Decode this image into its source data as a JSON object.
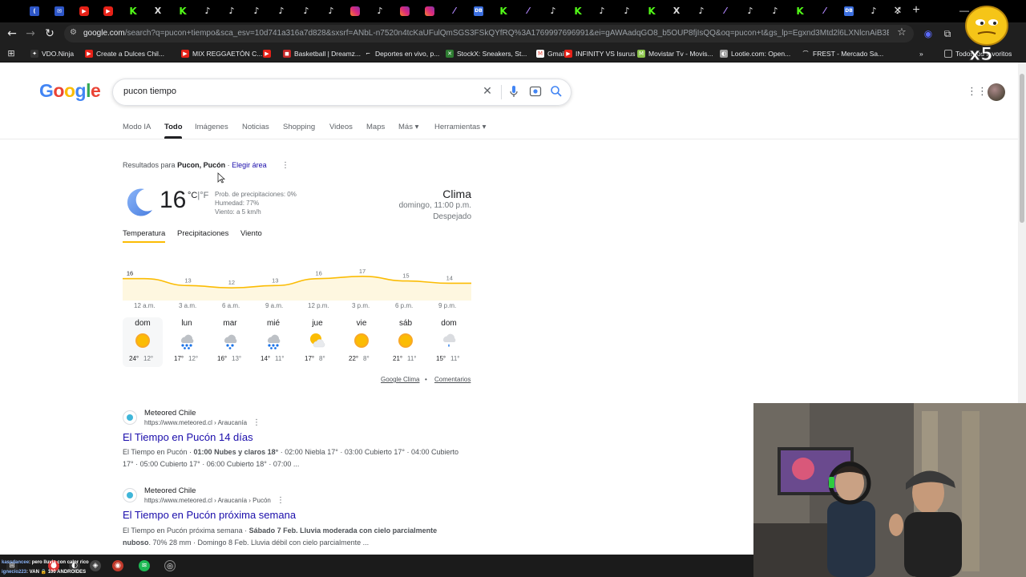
{
  "browser": {
    "tab_favicons": [
      {
        "kind": "msg",
        "glyph": "("
      },
      {
        "kind": "msg",
        "glyph": "✉"
      },
      {
        "kind": "yt",
        "glyph": "▶"
      },
      {
        "kind": "yt",
        "glyph": "▶"
      },
      {
        "kind": "kick",
        "glyph": "K"
      },
      {
        "kind": "x",
        "glyph": "X"
      },
      {
        "kind": "kick",
        "glyph": "K"
      },
      {
        "kind": "tt",
        "glyph": "♪"
      },
      {
        "kind": "tt",
        "glyph": "♪"
      },
      {
        "kind": "tt",
        "glyph": "♪"
      },
      {
        "kind": "tt",
        "glyph": "♪"
      },
      {
        "kind": "tt",
        "glyph": "♪"
      },
      {
        "kind": "tt",
        "glyph": "♪"
      },
      {
        "kind": "ig",
        "glyph": ""
      },
      {
        "kind": "tt",
        "glyph": "♪"
      },
      {
        "kind": "ig",
        "glyph": ""
      },
      {
        "kind": "ig",
        "glyph": ""
      },
      {
        "kind": "feather",
        "glyph": "⁄"
      },
      {
        "kind": "blue",
        "glyph": "DB"
      },
      {
        "kind": "kick",
        "glyph": "K"
      },
      {
        "kind": "feather",
        "glyph": "⁄"
      },
      {
        "kind": "tt",
        "glyph": "♪"
      },
      {
        "kind": "kick",
        "glyph": "K"
      },
      {
        "kind": "tt",
        "glyph": "♪"
      },
      {
        "kind": "tt",
        "glyph": "♪"
      },
      {
        "kind": "kick",
        "glyph": "K"
      },
      {
        "kind": "x",
        "glyph": "X"
      },
      {
        "kind": "tt",
        "glyph": "♪"
      },
      {
        "kind": "feather",
        "glyph": "⁄"
      },
      {
        "kind": "tt",
        "glyph": "♪"
      },
      {
        "kind": "tt",
        "glyph": "♪"
      },
      {
        "kind": "kick",
        "glyph": "K"
      },
      {
        "kind": "feather",
        "glyph": "⁄"
      },
      {
        "kind": "blue",
        "glyph": "DB"
      },
      {
        "kind": "tt",
        "glyph": "♪"
      },
      {
        "kind": "tt",
        "glyph": "♪"
      }
    ],
    "tab_close_glyph": "✕",
    "tab_new_glyph": "+",
    "url_domain": "google.com",
    "url_rest": "/search?q=pucon+tiempo&sca_esv=10d741a316a7d828&sxsrf=ANbL-n7520n4tcKaUFulQmSGS3FSkQYfRQ%3A1769997696991&ei=gAWAadqGO8_b5OUP8fjIsQQ&oq=pucon+t&gs_lp=Egxnd3Mtd2l6LXNlcnAiB3B1Y29uIHQqAggA...",
    "bookmarks": [
      {
        "label": "VDO.Ninja",
        "color": "#333",
        "glyph": "✦"
      },
      {
        "label": "Create a Dulces Chil...",
        "color": "#e62117",
        "glyph": "▶"
      },
      {
        "label": "MIX REGGAETÓN C...",
        "color": "#e62117",
        "glyph": "▶"
      },
      {
        "label": "",
        "color": "#e62117",
        "glyph": "▶"
      },
      {
        "label": "Basketball | Dreamz...",
        "color": "#c62828",
        "glyph": "◼"
      },
      {
        "label": "Deportes en vivo, p...",
        "color": "#1f1f1f",
        "glyph": "⌐"
      },
      {
        "label": "StockX: Sneakers, St...",
        "color": "#2e7d32",
        "glyph": "✕"
      },
      {
        "label": "Gmail",
        "color": "#fff",
        "glyph": "M"
      },
      {
        "label": "INFINITY VS Isurus",
        "color": "#e62117",
        "glyph": "▶"
      },
      {
        "label": "Movistar Tv - Movis...",
        "color": "#8bc34a",
        "glyph": "M"
      },
      {
        "label": "Lootie.com: Open...",
        "color": "#9e9e9e",
        "glyph": "◐"
      },
      {
        "label": "FREST - Mercado Sa...",
        "color": "#1f1f1f",
        "glyph": "⌒"
      }
    ],
    "bookmarks_overflow": "»",
    "all_bookmarks": "Todos los favoritos"
  },
  "search": {
    "query": "pucon tiempo",
    "logo_letters": [
      "G",
      "o",
      "o",
      "g",
      "l",
      "e"
    ],
    "clear_glyph": "✕",
    "mic_glyph": "🎤",
    "lens_glyph": "◎",
    "search_glyph": "⌕",
    "tabs": [
      "Modo IA",
      "Todo",
      "Imágenes",
      "Noticias",
      "Shopping",
      "Videos",
      "Maps",
      "Más ▾",
      "Herramientas ▾"
    ]
  },
  "weather": {
    "results_prefix": "Resultados para",
    "location": "Pucon, Pucón",
    "separator": "·",
    "choose_area": "Elegir área",
    "temp": "16",
    "unit_c": "°C",
    "unit_sep": "|",
    "unit_f": "°F",
    "precip": "Prob. de precipitaciones: 0%",
    "humidity": "Humedad: 77%",
    "wind": "Viento: a 5 km/h",
    "heading": "Clima",
    "when": "domingo, 11:00 p.m.",
    "condition": "Despejado",
    "tabs": [
      "Temperatura",
      "Precipitaciones",
      "Viento"
    ],
    "times": [
      "12 a.m.",
      "3 a.m.",
      "6 a.m.",
      "9 a.m.",
      "12 p.m.",
      "3 p.m.",
      "6 p.m.",
      "9 p.m."
    ],
    "footer_source": "Google Clima",
    "footer_dot": "•",
    "footer_feedback": "Comentarios",
    "days": [
      {
        "name": "dom",
        "icon": "sun",
        "hi": "24°",
        "lo": "12°"
      },
      {
        "name": "lun",
        "icon": "rain",
        "hi": "17°",
        "lo": "12°"
      },
      {
        "name": "mar",
        "icon": "rain-light",
        "hi": "16°",
        "lo": "13°"
      },
      {
        "name": "mié",
        "icon": "rain",
        "hi": "14°",
        "lo": "11°"
      },
      {
        "name": "jue",
        "icon": "partly-cloudy",
        "hi": "17°",
        "lo": "8°"
      },
      {
        "name": "vie",
        "icon": "sun",
        "hi": "22°",
        "lo": "8°"
      },
      {
        "name": "sáb",
        "icon": "sun",
        "hi": "21°",
        "lo": "11°"
      },
      {
        "name": "dom",
        "icon": "showers",
        "hi": "15°",
        "lo": "11°"
      }
    ]
  },
  "chart_data": {
    "type": "area",
    "x": [
      "12 a.m.",
      "3 a.m.",
      "6 a.m.",
      "9 a.m.",
      "12 p.m.",
      "3 p.m.",
      "6 p.m.",
      "9 p.m."
    ],
    "values": [
      16,
      13,
      12,
      13,
      16,
      17,
      15,
      14
    ],
    "color": "#fbbc04",
    "fill": "#fef7e0"
  },
  "results": [
    {
      "site": "Meteored Chile",
      "url": "https://www.meteored.cl › Araucanía",
      "title": "El Tiempo en Pucón 14 días",
      "snippet_1a": "El Tiempo en Pucón · ",
      "snippet_1b": "01:00 Nubes y claros 18°",
      "snippet_1c": " · 02:00 Niebla 17° · 03:00 Cubierto 17° · 04:00 Cubierto",
      "snippet_2": "17° · 05:00 Cubierto 17° · 06:00 Cubierto 18° · 07:00 ..."
    },
    {
      "site": "Meteored Chile",
      "url": "https://www.meteored.cl › Araucanía › Pucón",
      "title": "El Tiempo en Pucón próxima semana",
      "snippet_1a": "El Tiempo en Pucón próxima semana · ",
      "snippet_1b": "Sábado 7 Feb. Lluvia moderada con cielo parcialmente",
      "snippet_2b": "nuboso",
      "snippet_2": ". 70% 28 mm · Domingo 8 Feb. Lluvia débil con cielo parcialmente ..."
    }
  ],
  "overlay": {
    "emote_count": "x5",
    "chat_1_user": "kassdancee",
    "chat_1_text": ": pero lluvia con calor rico",
    "chat_2_user": "ignecio223",
    "chat_2_text": ": VAN 🔒 100 ANDROIDES"
  }
}
